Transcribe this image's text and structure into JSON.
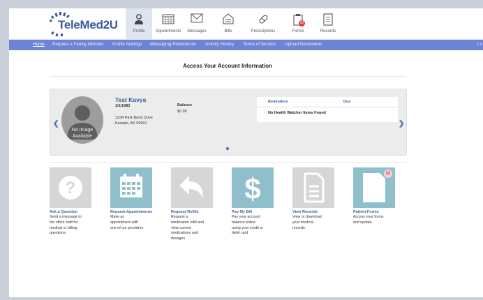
{
  "app": {
    "logo_text": "TeleMed2U"
  },
  "topnav": [
    {
      "label": "Profile",
      "icon": "person-icon",
      "active": true
    },
    {
      "label": "Appointments",
      "icon": "calendar-icon",
      "active": false
    },
    {
      "label": "Messages",
      "icon": "envelope-icon",
      "active": false
    },
    {
      "label": "Bills",
      "icon": "invoice-icon",
      "active": false
    },
    {
      "label": "Prescriptions",
      "icon": "pill-icon",
      "active": false
    },
    {
      "label": "Forms",
      "icon": "clipboard-icon",
      "active": false,
      "badge": "22"
    },
    {
      "label": "Records",
      "icon": "document-icon",
      "active": false
    }
  ],
  "menubar": {
    "items": [
      "Home",
      "Request a Family Member",
      "Profile Settings",
      "Messaging Preferences",
      "Activity History",
      "Terms of Service",
      "Upload Documents"
    ],
    "active": "Home",
    "right_cut": "Lo"
  },
  "main": {
    "heading": "Access Your Account Information"
  },
  "profile": {
    "name": "Test Kavya",
    "dob": "1/1/1982",
    "address_line1": "1234 Park Bend Drive",
    "address_line2": "Kasaan, AK 99901",
    "balance_label": "Balance",
    "balance_value": "$0.00",
    "no_image_line1": "No Image",
    "no_image_line2": "Available",
    "reminders_label": "Reminders",
    "due_label": "Due",
    "no_items": "No Health Watcher Items Found"
  },
  "tiles": [
    {
      "title": "Ask a Question",
      "desc": "Send a message to\nthe office staff for\nmedical or billing\nquestions.",
      "color": "#d6d6d6",
      "icon": "question-icon"
    },
    {
      "title": "Request Appointments",
      "desc": "Make an\nappointment with\none of our providers",
      "color": "#8fbfcb",
      "icon": "calendar-icon"
    },
    {
      "title": "Request Refills",
      "desc": "Request a\nmedication refill and\nview current\nmedications and\ndosages.",
      "color": "#d6d6d6",
      "icon": "reply-arrow-icon"
    },
    {
      "title": "Pay My Bill",
      "desc": "Pay your account\nbalance online\nusing your credit or\ndebit card.",
      "color": "#8fbfcb",
      "icon": "dollar-icon"
    },
    {
      "title": "View Records",
      "desc": "View or download\nyour medical\nrecords.",
      "color": "#d6d6d6",
      "icon": "document-icon"
    },
    {
      "title": "Patient Forms",
      "desc": "Access your forms\nand update",
      "color": "#8fbfcb",
      "icon": "form-icon",
      "badge": "22"
    }
  ],
  "colors": {
    "menubar": "#6d84d6",
    "link": "#34629f",
    "accent_tile": "#8fbfcb"
  }
}
